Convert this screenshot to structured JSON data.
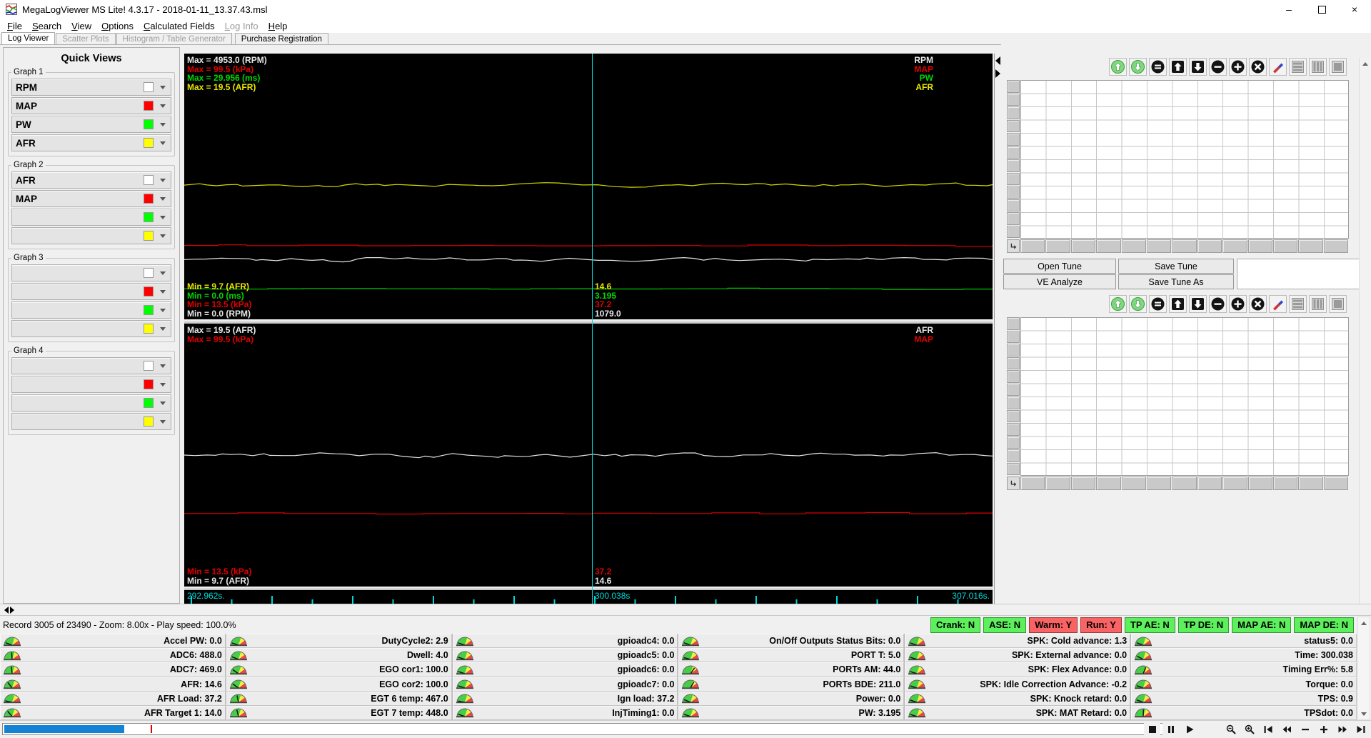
{
  "window": {
    "title": "MegaLogViewer MS Lite! 4.3.17 - 2018-01-11_13.37.43.msl",
    "controls": [
      "minimize",
      "maximize",
      "close"
    ]
  },
  "menu": {
    "items": [
      {
        "label": "File",
        "enabled": true
      },
      {
        "label": "Search",
        "enabled": true
      },
      {
        "label": "View",
        "enabled": true
      },
      {
        "label": "Options",
        "enabled": true
      },
      {
        "label": "Calculated Fields",
        "enabled": true
      },
      {
        "label": "Log Info",
        "enabled": false
      },
      {
        "label": "Help",
        "enabled": true
      }
    ]
  },
  "tabs": [
    {
      "label": "Log Viewer",
      "state": "active"
    },
    {
      "label": "Scatter Plots",
      "state": "disabled"
    },
    {
      "label": "Histogram / Table Generator",
      "state": "disabled"
    },
    {
      "label": "Purchase Registration",
      "state": "normal"
    }
  ],
  "sidebar": {
    "title": "Quick Views",
    "groups": [
      {
        "label": "Graph 1",
        "rows": [
          {
            "label": "RPM",
            "color": "#ffffff"
          },
          {
            "label": "MAP",
            "color": "#ff0000"
          },
          {
            "label": "PW",
            "color": "#00ff00"
          },
          {
            "label": "AFR",
            "color": "#ffff00"
          }
        ]
      },
      {
        "label": "Graph 2",
        "rows": [
          {
            "label": "AFR",
            "color": "#ffffff"
          },
          {
            "label": "MAP",
            "color": "#ff0000"
          },
          {
            "label": "",
            "color": "#00ff00"
          },
          {
            "label": "",
            "color": "#ffff00"
          }
        ]
      },
      {
        "label": "Graph 3",
        "rows": [
          {
            "label": "",
            "color": "#ffffff"
          },
          {
            "label": "",
            "color": "#ff0000"
          },
          {
            "label": "",
            "color": "#00ff00"
          },
          {
            "label": "",
            "color": "#ffff00"
          }
        ]
      },
      {
        "label": "Graph 4",
        "rows": [
          {
            "label": "",
            "color": "#ffffff"
          },
          {
            "label": "",
            "color": "#ff0000"
          },
          {
            "label": "",
            "color": "#00ff00"
          },
          {
            "label": "",
            "color": "#ffff00"
          }
        ]
      }
    ]
  },
  "graphs": [
    {
      "max_labels": [
        {
          "text": "Max = 4953.0 (RPM)",
          "color": "#e8e8e8"
        },
        {
          "text": "Max = 99.5 (kPa)",
          "color": "#e00000"
        },
        {
          "text": "Max = 29.956 (ms)",
          "color": "#00d800"
        },
        {
          "text": "Max = 19.5 (AFR)",
          "color": "#e8e800"
        }
      ],
      "channel_labels": [
        {
          "text": "RPM",
          "color": "#e8e8e8"
        },
        {
          "text": "MAP",
          "color": "#e00000"
        },
        {
          "text": "PW",
          "color": "#00d800"
        },
        {
          "text": "AFR",
          "color": "#e8e800"
        }
      ],
      "min_labels": [
        {
          "text": "Min = 9.7 (AFR)",
          "color": "#e8e800"
        },
        {
          "text": "Min = 0.0 (ms)",
          "color": "#00d800"
        },
        {
          "text": "Min = 13.5 (kPa)",
          "color": "#e00000"
        },
        {
          "text": "Min = 0.0 (RPM)",
          "color": "#e8e8e8"
        }
      ],
      "cursor_values": [
        {
          "text": "14.6",
          "color": "#e8e800"
        },
        {
          "text": "3.195",
          "color": "#00d800"
        },
        {
          "text": "37.2",
          "color": "#e00000"
        },
        {
          "text": "1079.0",
          "color": "#e8e8e8"
        }
      ],
      "traces": [
        {
          "name": "AFR",
          "color": "#d8d800",
          "base": 0.495,
          "amp": 2.0,
          "kind": "wavy",
          "seed": 11
        },
        {
          "name": "MAP",
          "color": "#dd0000",
          "base": 0.722,
          "amp": 1.1,
          "kind": "step",
          "seed": 23
        },
        {
          "name": "RPM",
          "color": "#e2e2e2",
          "base": 0.775,
          "amp": 2.2,
          "kind": "wavy",
          "seed": 5
        },
        {
          "name": "PW",
          "color": "#00c800",
          "base": 0.885,
          "amp": 0.8,
          "kind": "step",
          "seed": 41
        }
      ]
    },
    {
      "max_labels": [
        {
          "text": "Max = 19.5 (AFR)",
          "color": "#e8e8e8"
        },
        {
          "text": "Max = 99.5 (kPa)",
          "color": "#e00000"
        }
      ],
      "channel_labels": [
        {
          "text": "AFR",
          "color": "#e8e8e8"
        },
        {
          "text": "MAP",
          "color": "#e00000"
        }
      ],
      "min_labels": [
        {
          "text": "Min = 13.5 (kPa)",
          "color": "#e00000"
        },
        {
          "text": "Min = 9.7 (AFR)",
          "color": "#e8e8e8"
        }
      ],
      "cursor_values": [
        {
          "text": "37.2",
          "color": "#e00000"
        },
        {
          "text": "14.6",
          "color": "#e8e8e8"
        }
      ],
      "traces": [
        {
          "name": "AFR",
          "color": "#e2e2e2",
          "base": 0.5,
          "amp": 2.4,
          "kind": "wavy",
          "seed": 9
        },
        {
          "name": "MAP",
          "color": "#dd0000",
          "base": 0.722,
          "amp": 1.2,
          "kind": "step",
          "seed": 17
        }
      ]
    }
  ],
  "time_axis": {
    "start": "292.962s.",
    "cursor": "300.038s",
    "end": "307.016s.",
    "color": "#00d8d8",
    "cursor_x_frac": 0.505
  },
  "right_panel": {
    "toolbar_icons": [
      "shift-up-green",
      "shift-down-green",
      "equalize",
      "arrow-up",
      "arrow-down",
      "decrement",
      "increment",
      "clear",
      "edit-pencil",
      "row-view",
      "column-view",
      "block-view"
    ],
    "buttons": {
      "open_tune": "Open Tune",
      "save_tune": "Save Tune",
      "ve_analyze": "VE Analyze",
      "save_tune_as": "Save Tune As"
    },
    "grid": {
      "cols": 13,
      "rows": 12
    }
  },
  "status_bar": {
    "record_text": "Record 3005 of 23490 - Zoom: 8.00x - Play speed: 100.0%",
    "badge_colors": {
      "green": "#5df05d",
      "red": "#f96363"
    },
    "badges": [
      {
        "label": "Crank: N",
        "state": "green"
      },
      {
        "label": "ASE: N",
        "state": "green"
      },
      {
        "label": "Warm: Y",
        "state": "red"
      },
      {
        "label": "Run: Y",
        "state": "red"
      },
      {
        "label": "TP AE: N",
        "state": "green"
      },
      {
        "label": "TP DE: N",
        "state": "green"
      },
      {
        "label": "MAP AE: N",
        "state": "green"
      },
      {
        "label": "MAP DE: N",
        "state": "green"
      }
    ]
  },
  "gauges": {
    "columns": [
      [
        {
          "label": "Accel PW",
          "value": "0.0",
          "needle": -70
        },
        {
          "label": "ADC6",
          "value": "488.0",
          "needle": -4
        },
        {
          "label": "ADC7",
          "value": "469.0",
          "needle": -6
        },
        {
          "label": "AFR",
          "value": "14.6",
          "needle": -38
        },
        {
          "label": "AFR Load",
          "value": "37.2",
          "needle": -78
        },
        {
          "label": "AFR Target 1",
          "value": "14.0",
          "needle": -40
        }
      ],
      [
        {
          "label": "DutyCycle2",
          "value": "2.9",
          "needle": -72
        },
        {
          "label": "Dwell",
          "value": "4.0",
          "needle": -68
        },
        {
          "label": "EGO cor1",
          "value": "100.0",
          "needle": -55
        },
        {
          "label": "EGO cor2",
          "value": "100.0",
          "needle": -55
        },
        {
          "label": "EGT 6 temp",
          "value": "467.0",
          "needle": -12
        },
        {
          "label": "EGT 7 temp",
          "value": "448.0",
          "needle": -14
        }
      ],
      [
        {
          "label": "gpioadc4",
          "value": "0.0",
          "needle": -72
        },
        {
          "label": "gpioadc5",
          "value": "0.0",
          "needle": -72
        },
        {
          "label": "gpioadc6",
          "value": "0.0",
          "needle": -72
        },
        {
          "label": "gpioadc7",
          "value": "0.0",
          "needle": -72
        },
        {
          "label": "Ign load",
          "value": "37.2",
          "needle": -80
        },
        {
          "label": "InjTiming1",
          "value": "0.0",
          "needle": -70
        }
      ],
      [
        {
          "label": "On/Off Outputs Status Bits",
          "value": "0.0",
          "needle": -70
        },
        {
          "label": "PORT T",
          "value": "5.0",
          "needle": -75
        },
        {
          "label": "PORTs AM",
          "value": "44.0",
          "needle": 35
        },
        {
          "label": "PORTs BDE",
          "value": "211.0",
          "needle": 28
        },
        {
          "label": "Power",
          "value": "0.0",
          "needle": -68
        },
        {
          "label": "PW",
          "value": "3.195",
          "needle": -70
        }
      ],
      [
        {
          "label": "SPK: Cold advance",
          "value": "1.3",
          "needle": -72
        },
        {
          "label": "SPK: External advance",
          "value": "0.0",
          "needle": -72
        },
        {
          "label": "SPK: Flex Advance",
          "value": "0.0",
          "needle": -72
        },
        {
          "label": "SPK: Idle Correction Advance",
          "value": "-0.2",
          "needle": -72
        },
        {
          "label": "SPK: Knock retard",
          "value": "0.0",
          "needle": -72
        },
        {
          "label": "SPK: MAT Retard",
          "value": "0.0",
          "needle": -72
        }
      ],
      [
        {
          "label": "status5",
          "value": "0.0",
          "needle": -70
        },
        {
          "label": "Time",
          "value": "300.038",
          "needle": -62
        },
        {
          "label": "Timing Err%",
          "value": "5.8",
          "needle": 22
        },
        {
          "label": "Torque",
          "value": "0.0",
          "needle": -70
        },
        {
          "label": "TPS",
          "value": "0.9",
          "needle": -70
        },
        {
          "label": "TPSdot",
          "value": "0.0",
          "needle": 2
        }
      ]
    ]
  },
  "transport": {
    "buttons": [
      "stop",
      "pause",
      "play",
      "zoom-out",
      "zoom-in",
      "skip-start",
      "rewind",
      "speed-minus",
      "speed-plus",
      "fast-forward",
      "skip-end"
    ],
    "progress": {
      "fill_frac": 0.104,
      "marker_frac": 0.128
    }
  }
}
